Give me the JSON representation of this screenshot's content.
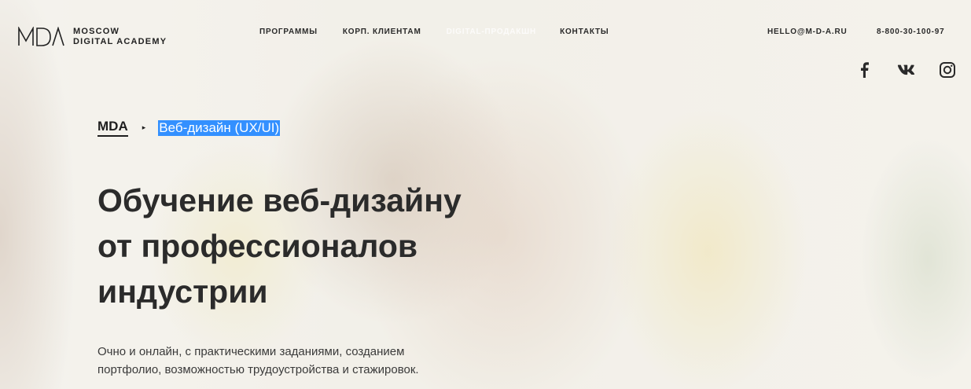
{
  "header": {
    "logo": {
      "mark": "MDA",
      "line1": "MOSCOW",
      "line2": "DIGITAL ACADEMY"
    },
    "nav": [
      {
        "label": "ПРОГРАММЫ",
        "faded": false
      },
      {
        "label": "КОРП. КЛИЕНТАМ",
        "faded": false
      },
      {
        "label": "DIGITAL-ПРОДАКШН",
        "faded": true
      },
      {
        "label": "КОНТАКТЫ",
        "faded": false
      }
    ],
    "email": "HELLO@M-D-A.RU",
    "phone": "8-800-30-100-97",
    "social": [
      {
        "icon": "facebook-icon",
        "glyph": "f"
      },
      {
        "icon": "vk-icon",
        "glyph": "vk"
      },
      {
        "icon": "instagram-icon",
        "glyph": "ig"
      }
    ]
  },
  "breadcrumb": {
    "home": "MDA",
    "separator": "▸",
    "current": "Веб-дизайн (UX/UI)"
  },
  "hero": {
    "title_lines": [
      "Обучение веб-дизайну",
      "от профессионалов",
      "индустрии"
    ],
    "description_lines": [
      "Очно и онлайн, с практическими заданиями, созданием",
      "портфолио, возможностью трудоустройства и стажировок."
    ]
  },
  "colors": {
    "text": "#2b2b2b",
    "selection": "#3390ff"
  }
}
